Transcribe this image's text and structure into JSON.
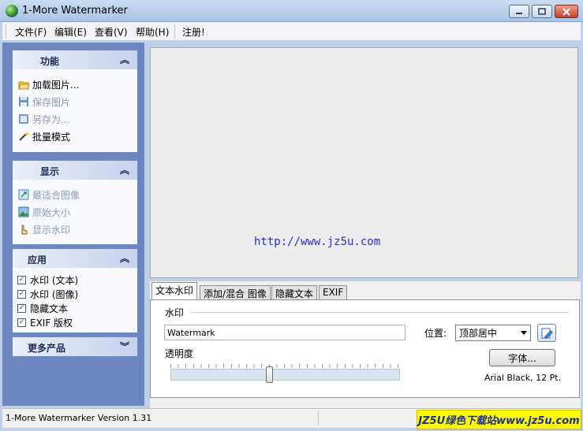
{
  "window": {
    "title": "1-More Watermarker"
  },
  "menu": {
    "file": "文件(F)",
    "edit": "编辑(E)",
    "view": "查看(V)",
    "help": "帮助(H)",
    "register": "注册!"
  },
  "sidebar": {
    "function": {
      "title": "功能",
      "items": [
        "加载图片...",
        "保存图片",
        "另存为...",
        "批量模式"
      ]
    },
    "display": {
      "title": "显示",
      "items": [
        "最适合图像",
        "原始大小",
        "显示水印"
      ]
    },
    "apply": {
      "title": "应用",
      "checks": [
        "水印 (文本)",
        "水印 (图像)",
        "隐藏文本",
        "EXIF 版权"
      ]
    },
    "more": {
      "title": "更多产品"
    }
  },
  "preview": {
    "url_text": "http://www.jz5u.com"
  },
  "tabs": [
    "文本水印",
    "添加/混合 图像",
    "隐藏文本",
    "EXIF"
  ],
  "text_tab": {
    "group_title": "水印",
    "watermark_value": "Watermark",
    "position_label": "位置:",
    "position_value": "顶部居中",
    "opacity_label": "透明度",
    "opacity_level": 0.43,
    "font_button": "字体...",
    "font_info": "Arial Black, 12 Pt."
  },
  "status": {
    "version": "1-More Watermarker Version 1.31"
  },
  "watermark_logo": "JZ5U绿色下载站www.jz5u.com"
}
